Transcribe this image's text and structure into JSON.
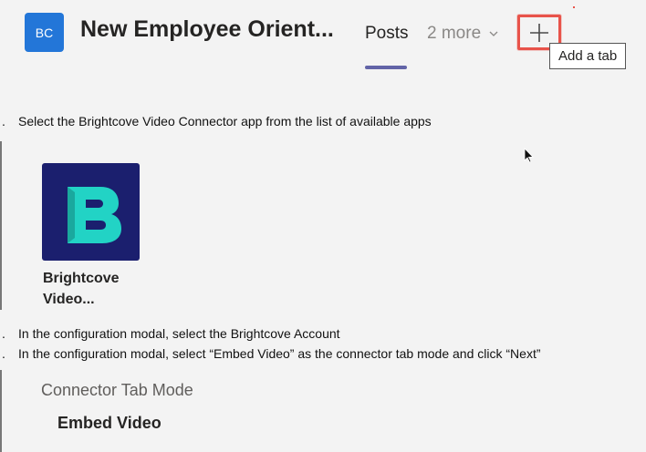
{
  "header": {
    "avatar_initials": "BC",
    "team_title": "New Employee Orient...",
    "tabs": [
      {
        "label": "Posts",
        "active": true
      },
      {
        "label": "2 more"
      }
    ],
    "add_tab_tooltip": "Add a tab"
  },
  "steps": [
    {
      "num": ".",
      "text": "Select the Brightcove Video Connector app from the list of available apps"
    },
    {
      "num": ".",
      "text": "In the configuration modal, select the Brightcove Account"
    },
    {
      "num": ".",
      "text": "In the configuration modal, select “Embed Video” as the connector tab mode and click “Next”"
    }
  ],
  "app": {
    "name_line1": "Brightcove",
    "name_line2": "Video...",
    "tile_color": "#1b1f6e",
    "logo_color": "#22d3c5"
  },
  "config": {
    "label": "Connector Tab Mode",
    "value": "Embed Video"
  },
  "colors": {
    "accent": "#6264a7",
    "avatar": "#2376d8",
    "highlight": "#e8534a"
  }
}
